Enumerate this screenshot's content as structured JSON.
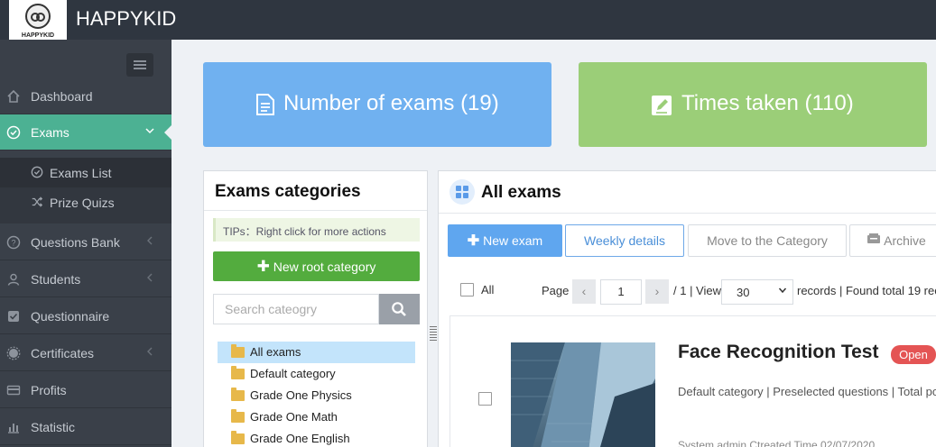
{
  "header": {
    "logo_text": "HAPPYKID",
    "app_title": "HAPPYKID"
  },
  "sidebar": {
    "items": [
      {
        "label": "Dashboard",
        "icon": "home-icon"
      },
      {
        "label": "Exams",
        "icon": "check-circle-icon",
        "active": true
      },
      {
        "label": "Questions Bank",
        "icon": "question-circle-icon"
      },
      {
        "label": "Students",
        "icon": "user-icon"
      },
      {
        "label": "Questionnaire",
        "icon": "checkbox-icon"
      },
      {
        "label": "Certificates",
        "icon": "badge-icon"
      },
      {
        "label": "Profits",
        "icon": "card-icon"
      },
      {
        "label": "Statistic",
        "icon": "bar-chart-icon"
      }
    ],
    "sub_items": [
      {
        "label": "Exams List",
        "icon": "check-circle-icon",
        "active": true
      },
      {
        "label": "Prize Quizs",
        "icon": "shuffle-icon"
      }
    ]
  },
  "stats": {
    "exams": "Number of exams (19)",
    "taken": "Times taken (110)"
  },
  "categories": {
    "title": "Exams categories",
    "tips": "TIPs：Right click for more actions",
    "new_root": "New root category",
    "search_placeholder": "Search cateogry",
    "tree": [
      "All exams",
      "Default category",
      "Grade One Physics",
      "Grade One Math",
      "Grade One English"
    ]
  },
  "exams": {
    "title": "All exams",
    "toolbar": {
      "new_exam": "New exam",
      "weekly": "Weekly details",
      "move": "Move to the Category",
      "archive": "Archive"
    },
    "pager": {
      "all_label": "All",
      "page_label": "Page",
      "page_value": "1",
      "total_pages": "/ 1 | View",
      "page_size": "30",
      "records_text": "records | Found total 19 rec"
    },
    "item": {
      "name": "Face Recognition Test",
      "status": "Open",
      "meta": "Default category | Preselected questions | Total po",
      "footer": "System admin    Ctreated Time 02/07/2020"
    }
  },
  "colors": {
    "topbar": "#2f3640",
    "sidebar": "#3a4049",
    "active": "#4cb193",
    "stat_blue": "#70b1f0",
    "stat_green": "#9bce78",
    "primary": "#5fa6ef",
    "success": "#53ac3e",
    "danger": "#e45454"
  }
}
